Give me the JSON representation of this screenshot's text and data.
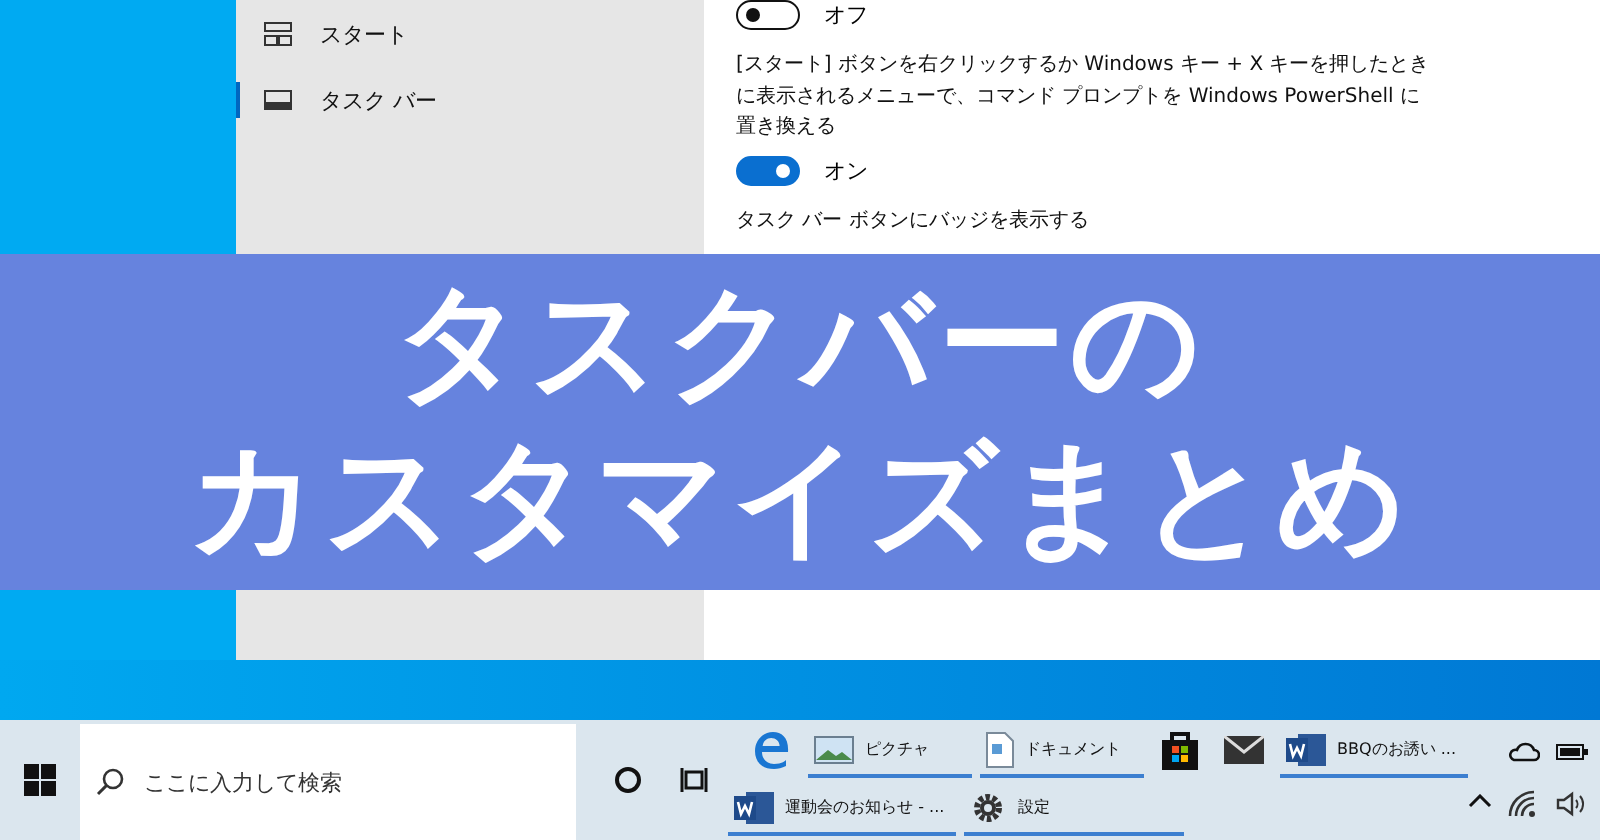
{
  "settings": {
    "sidebar": [
      {
        "label": "スタート",
        "selected": false
      },
      {
        "label": "タスク バー",
        "selected": true
      }
    ],
    "content": [
      {
        "kind": "toggle",
        "on": false,
        "label": "オフ"
      },
      {
        "kind": "text",
        "text": "[スタート] ボタンを右クリックするか Windows キー + X キーを押したときに表示されるメニューで、コマンド プロンプトを Windows PowerShell に置き換える"
      },
      {
        "kind": "toggle",
        "on": true,
        "label": "オン"
      },
      {
        "kind": "text",
        "text": "タスク バー ボタンにバッジを表示する"
      }
    ]
  },
  "banner": {
    "lines": [
      "タスクバーの",
      "カスタマイズまとめ"
    ]
  },
  "taskbar": {
    "search": {
      "placeholder": "ここに入力して検索"
    },
    "upper_row": [
      {
        "kind": "browser",
        "running": false
      },
      {
        "kind": "pictures",
        "label": "ピクチャ",
        "running": true
      },
      {
        "kind": "documents",
        "label": "ドキュメント",
        "running": true
      },
      {
        "kind": "store",
        "running": false
      },
      {
        "kind": "mail",
        "running": false
      },
      {
        "kind": "word",
        "label": "BBQのお誘い ...",
        "running": true
      }
    ],
    "lower_row": [
      {
        "kind": "word",
        "label": "運動会のお知らせ - ...",
        "running": true
      },
      {
        "kind": "settings",
        "label": "設定",
        "running": true
      }
    ]
  }
}
